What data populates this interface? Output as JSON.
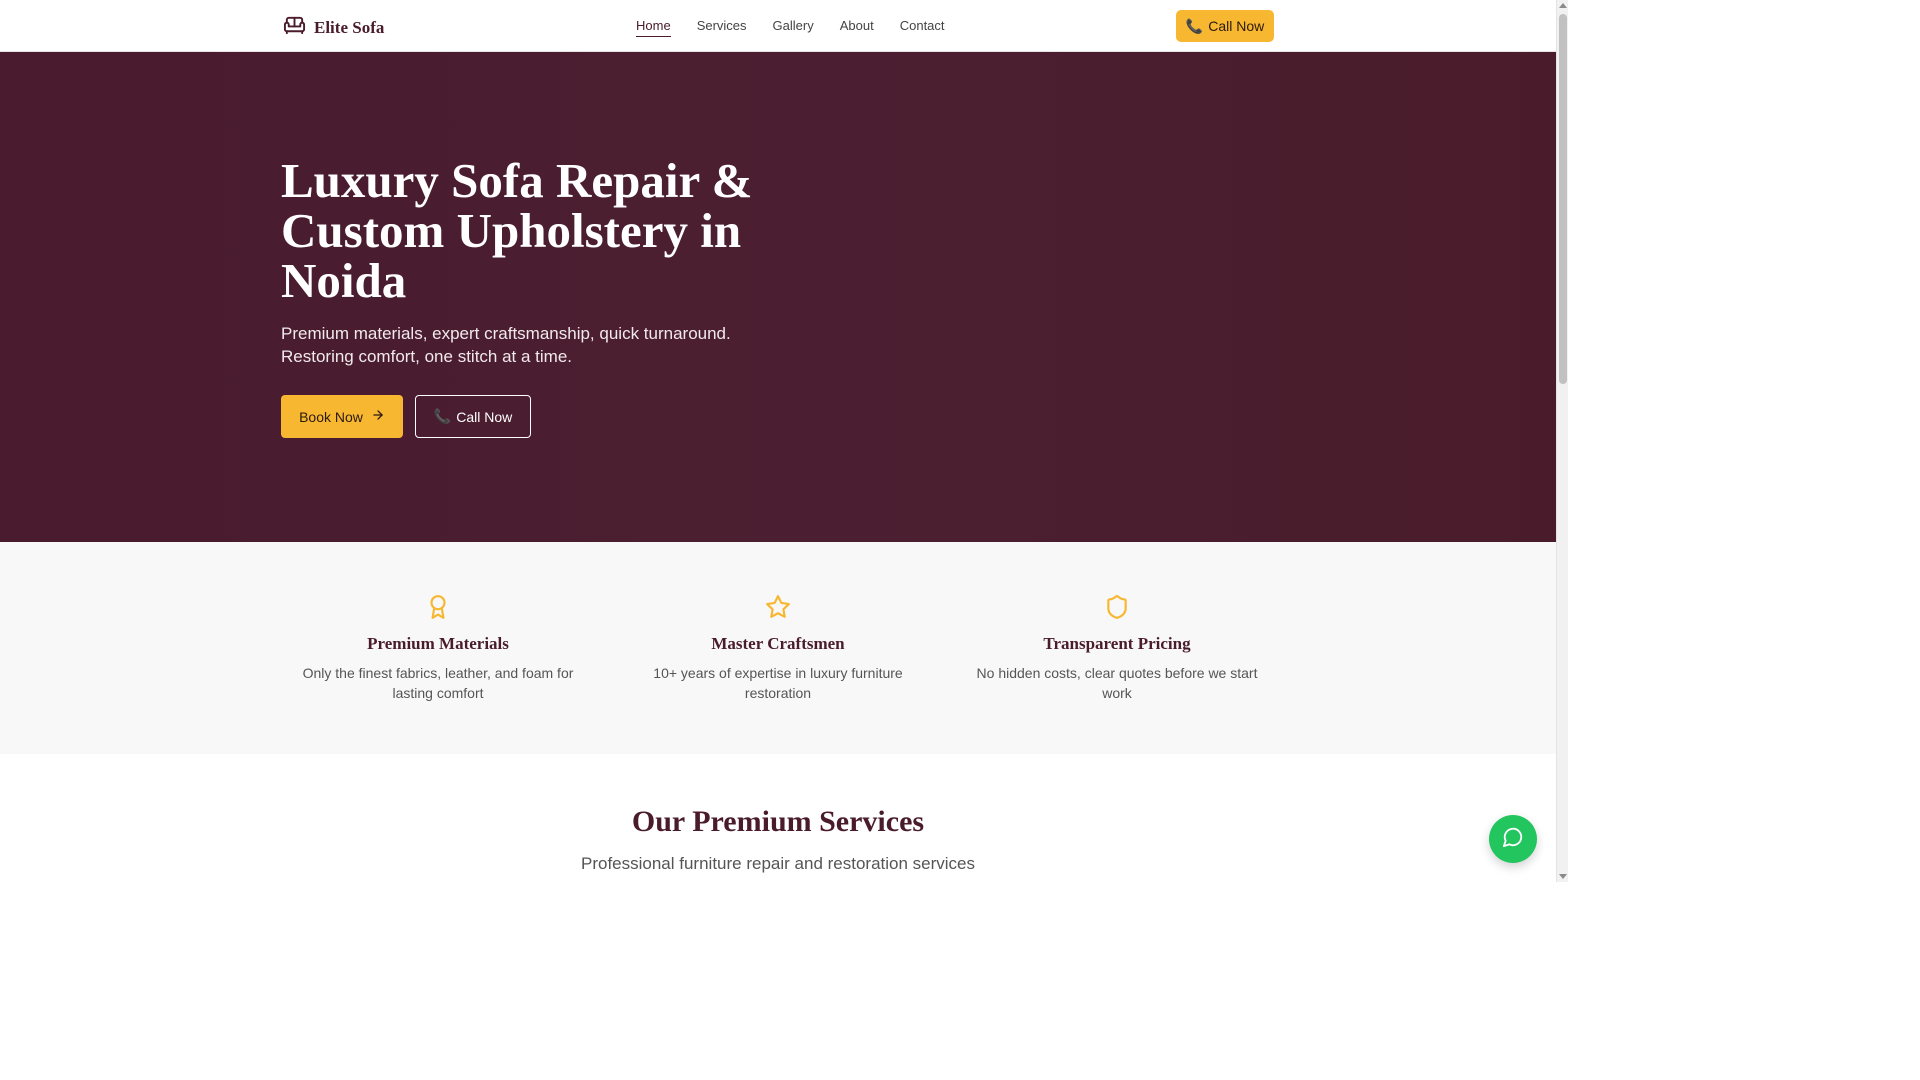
{
  "nav": {
    "brand": "Elite Sofa",
    "brand_icon": "sofa-icon",
    "links": [
      "Home",
      "Services",
      "Gallery",
      "About",
      "Contact"
    ],
    "active_link": "Home",
    "call_label": "Call Now",
    "call_icon": "phone-icon"
  },
  "hero": {
    "title": "Luxury Sofa Repair & Custom Upholstery in Noida",
    "subtitle": "Premium materials, expert craftsmanship, quick turnaround. Restoring comfort, one stitch at a time.",
    "book_label": "Book Now",
    "book_icon": "arrow-right-icon",
    "call_label": "Call Now",
    "call_icon": "phone-icon"
  },
  "features": [
    {
      "icon": "award-icon",
      "title": "Premium Materials",
      "desc": "Only the finest fabrics, leather, and foam for lasting comfort"
    },
    {
      "icon": "star-icon",
      "title": "Master Craftsmen",
      "desc": "10+ years of expertise in luxury furniture restoration"
    },
    {
      "icon": "shield-icon",
      "title": "Transparent Pricing",
      "desc": "No hidden costs, clear quotes before we start work"
    }
  ],
  "services": {
    "title": "Our Premium Services",
    "subtitle": "Professional furniture repair and restoration services"
  },
  "fab": {
    "icon": "whatsapp-chat-icon"
  },
  "colors": {
    "primary": "#4a1c2b",
    "accent": "#f7b731",
    "fab": "#22c55e"
  }
}
